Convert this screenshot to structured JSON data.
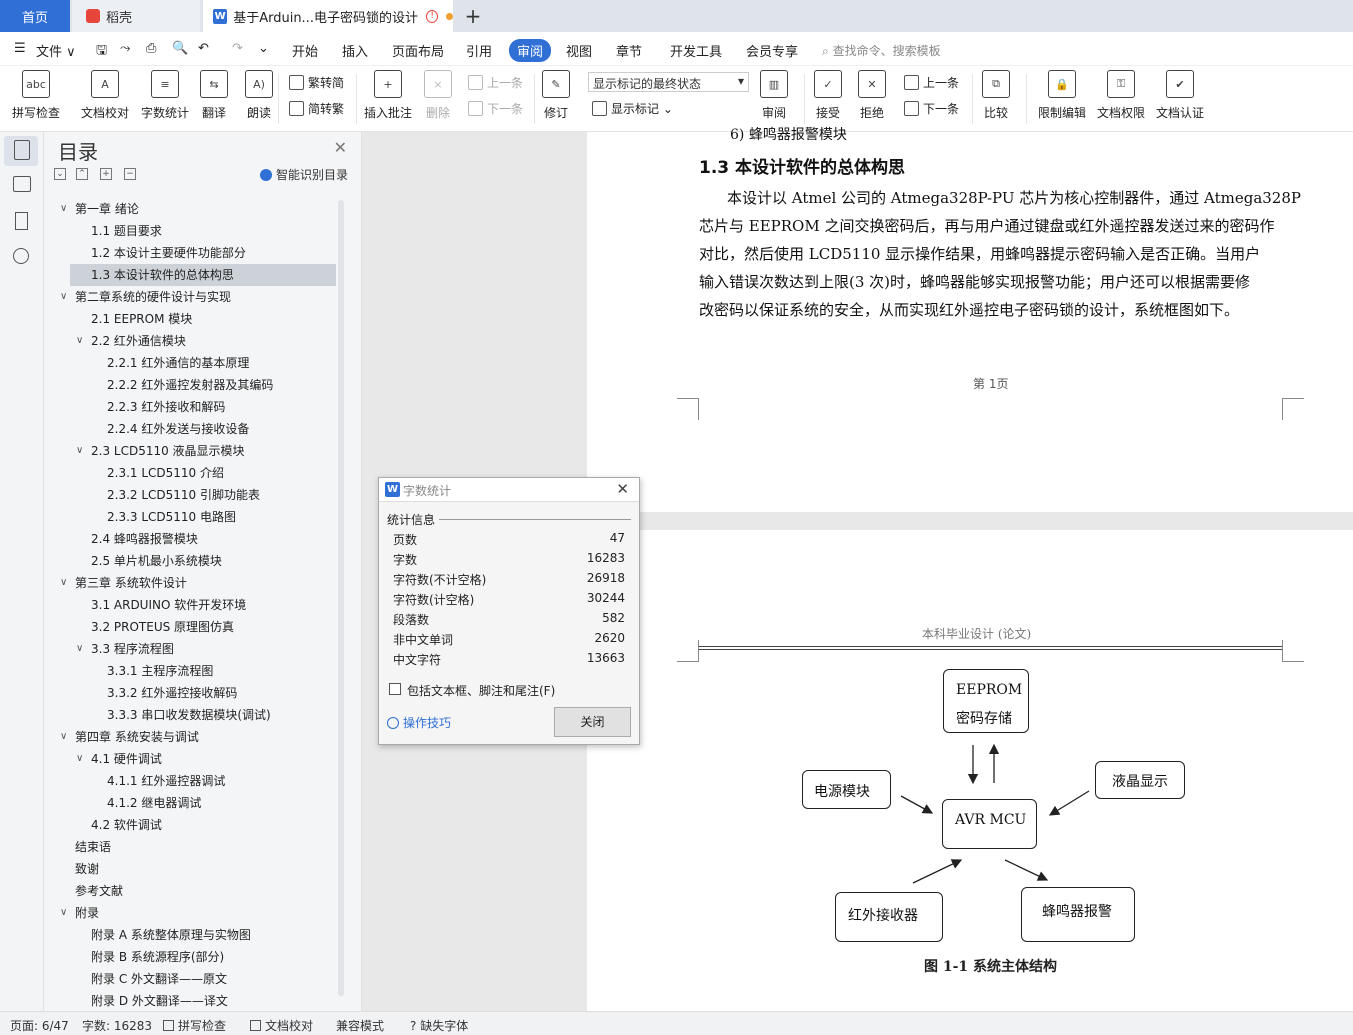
{
  "tabs": {
    "home": "首页",
    "daoke": "稻壳",
    "doc": "基于Arduin...电子密码锁的设计",
    "add": "+"
  },
  "menu": {
    "file": "文件",
    "items": [
      "开始",
      "插入",
      "页面布局",
      "引用",
      "审阅",
      "视图",
      "章节",
      "开发工具",
      "会员专享"
    ],
    "search": "查找命令、搜索模板"
  },
  "ribbon": {
    "spell": "拼写检查",
    "proof": "文档校对",
    "wordcount": "字数统计",
    "translate": "翻译",
    "read": "朗读",
    "trad2simp": "繁转简",
    "simp2trad": "简转繁",
    "insert_comment": "插入批注",
    "delete": "删除",
    "prev_c": "上一条",
    "next_c": "下一条",
    "track": "修订",
    "markup_state": "显示标记的最终状态",
    "show_markup": "显示标记",
    "review_pane": "审阅",
    "accept": "接受",
    "reject": "拒绝",
    "prev": "上一条",
    "next": "下一条",
    "compare": "比较",
    "restrict": "限制编辑",
    "permission": "文档权限",
    "certify": "文档认证"
  },
  "toc": {
    "title": "目录",
    "ai_label": "智能识别目录",
    "items": [
      {
        "text": "第一章  绪论",
        "level": 0,
        "arrow": "∨"
      },
      {
        "text": "1.1    题目要求",
        "level": 1
      },
      {
        "text": "1.2    本设计主要硬件功能部分",
        "level": 1
      },
      {
        "text": "1.3    本设计软件的总体构思",
        "level": 1,
        "selected": true
      },
      {
        "text": "第二章系统的硬件设计与实现",
        "level": 0,
        "arrow": "∨"
      },
      {
        "text": "2.1    EEPROM 模块",
        "level": 1
      },
      {
        "text": "2.2    红外通信模块",
        "level": 1,
        "arrow": "∨"
      },
      {
        "text": "2.2.1    红外通信的基本原理",
        "level": 2
      },
      {
        "text": "2.2.2    红外遥控发射器及其编码",
        "level": 2
      },
      {
        "text": "2.2.3    红外接收和解码",
        "level": 2
      },
      {
        "text": "2.2.4    红外发送与接收设备",
        "level": 2
      },
      {
        "text": "2.3    LCD5110 液晶显示模块",
        "level": 1,
        "arrow": "∨"
      },
      {
        "text": "2.3.1    LCD5110 介绍",
        "level": 2
      },
      {
        "text": "2.3.2    LCD5110 引脚功能表",
        "level": 2
      },
      {
        "text": "2.3.3    LCD5110 电路图",
        "level": 2
      },
      {
        "text": "2.4      蜂鸣器报警模块",
        "level": 1
      },
      {
        "text": "2.5    单片机最小系统模块",
        "level": 1
      },
      {
        "text": "第三章  系统软件设计",
        "level": 0,
        "arrow": "∨"
      },
      {
        "text": "3.1    ARDUINO 软件开发环境",
        "level": 1
      },
      {
        "text": "3.2    PROTEUS 原理图仿真",
        "level": 1
      },
      {
        "text": "3.3    程序流程图",
        "level": 1,
        "arrow": "∨"
      },
      {
        "text": "3.3.1    主程序流程图",
        "level": 2
      },
      {
        "text": "3.3.2    红外遥控接收解码",
        "level": 2
      },
      {
        "text": "3.3.3    串口收发数据模块(调试)",
        "level": 2
      },
      {
        "text": "第四章  系统安装与调试",
        "level": 0,
        "arrow": "∨"
      },
      {
        "text": "4.1    硬件调试",
        "level": 1,
        "arrow": "∨"
      },
      {
        "text": "4.1.1 红外遥控器调试",
        "level": 2
      },
      {
        "text": "4.1.2 继电器调试",
        "level": 2
      },
      {
        "text": "4.2  软件调试",
        "level": 1
      },
      {
        "text": "结束语",
        "level": 0
      },
      {
        "text": "致谢",
        "level": 0
      },
      {
        "text": "参考文献",
        "level": 0
      },
      {
        "text": "附录",
        "level": 0,
        "arrow": "∨"
      },
      {
        "text": "附录 A    系统整体原理与实物图",
        "level": 1
      },
      {
        "text": "附录 B    系统源程序(部分)",
        "level": 1
      },
      {
        "text": "附录 C    外文翻译——原文",
        "level": 1
      },
      {
        "text": "附录 D    外文翻译——译文",
        "level": 1
      }
    ]
  },
  "document": {
    "prev_line": "6)  蜂鸣器报警模块",
    "heading": "1.3  本设计软件的总体构思",
    "para": [
      "本设计以 Atmel 公司的 Atmega328P-PU 芯片为核心控制器件，通过 Atmega328P",
      "芯片与 EEPROM 之间交换密码后，再与用户通过键盘或红外遥控器发送过来的密码作",
      "对比，然后使用 LCD5110 显示操作结果，用蜂鸣器提示密码输入是否正确。当用户",
      "输入错误次数达到上限(3 次)时，蜂鸣器能够实现报警功能；用户还可以根据需要修",
      "改密码以保证系统的安全，从而实现红外遥控电子密码锁的设计，系统框图如下。"
    ],
    "page_footer": "第 1页",
    "header2": "本科毕业设计 (论文)",
    "diagram": {
      "eeprom": "EEPROM",
      "eeprom_sub": "密码存储",
      "power": "电源模块",
      "lcd": "液晶显示",
      "mcu": "AVR MCU",
      "ir": "红外接收器",
      "buzzer": "蜂鸣器报警"
    },
    "caption": "图 1-1 系统主体结构"
  },
  "dialog": {
    "title": "字数统计",
    "section": "统计信息",
    "rows": [
      {
        "label": "页数",
        "value": "47"
      },
      {
        "label": "字数",
        "value": "16283"
      },
      {
        "label": "字符数(不计空格)",
        "value": "26918"
      },
      {
        "label": "字符数(计空格)",
        "value": "30244"
      },
      {
        "label": "段落数",
        "value": "582"
      },
      {
        "label": "非中文单词",
        "value": "2620"
      },
      {
        "label": "中文字符",
        "value": "13663"
      }
    ],
    "checkbox": "包括文本框、脚注和尾注(F)",
    "tips": "操作技巧",
    "close": "关闭"
  },
  "status": {
    "page": "页面: 6/47",
    "words": "字数: 16283",
    "spell": "拼写检查",
    "proof": "文档校对",
    "compat": "兼容模式",
    "missing_font": "缺失字体"
  }
}
